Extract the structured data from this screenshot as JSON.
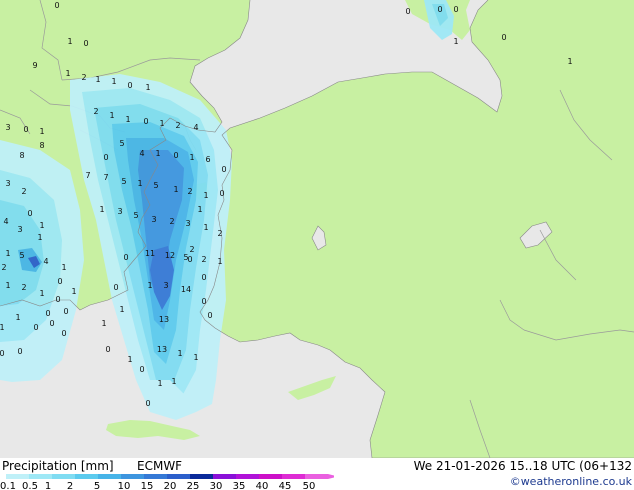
{
  "title": "Precipitation [mm]",
  "model": "ECMWF",
  "valid_time": "We 21-01-2026 15..18 UTC (06+132",
  "credit": "©weatheronline.co.uk",
  "colors": {
    "sea": "#e8e8e8",
    "land": "#c8f0a2",
    "border": "#9a9a9a",
    "coast": "#888888"
  },
  "legend": {
    "labels": [
      "0.1",
      "0.5",
      "1",
      "2",
      "5",
      "10",
      "15",
      "20",
      "25",
      "30",
      "35",
      "40",
      "45",
      "50"
    ],
    "colors": [
      "#bff0f8",
      "#9ee8f6",
      "#7fdcf2",
      "#5ccbee",
      "#47b4e8",
      "#3d95df",
      "#3579d6",
      "#2c5fcb",
      "#0a2a9a",
      "#8a10d8",
      "#b012d8",
      "#cc10c8",
      "#de2cd4",
      "#ea60e0"
    ]
  },
  "map_values": [
    "0",
    "1",
    "0",
    "9",
    "1",
    "2",
    "1",
    "1",
    "0",
    "1",
    "2",
    "1",
    "1",
    "0",
    "1",
    "2",
    "4",
    "4",
    "1",
    "0",
    "1",
    "6",
    "0",
    "5",
    "7",
    "7",
    "5",
    "1",
    "5",
    "1",
    "2",
    "1",
    "1",
    "3",
    "5",
    "3",
    "2",
    "3",
    "8",
    "8",
    "3",
    "0",
    "1",
    "3",
    "2",
    "4",
    "3",
    "1",
    "1",
    "5",
    "4",
    "1",
    "1",
    "2",
    "1",
    "0",
    "11",
    "12",
    "5",
    "2",
    "1",
    "1",
    "14",
    "3",
    "13",
    "13",
    "1",
    "1",
    "1",
    "0",
    "1",
    "0",
    "0",
    "0",
    "1",
    "1",
    "0",
    "0",
    "0",
    "0",
    "1",
    "1",
    "0",
    "1",
    "0",
    "0",
    "0",
    "0",
    "1",
    "2",
    "1",
    "0",
    "0",
    "0",
    "0",
    "1",
    "0",
    "2",
    "0",
    "1",
    "0",
    "0",
    "0",
    "1",
    "0",
    "1",
    "2",
    "0"
  ]
}
